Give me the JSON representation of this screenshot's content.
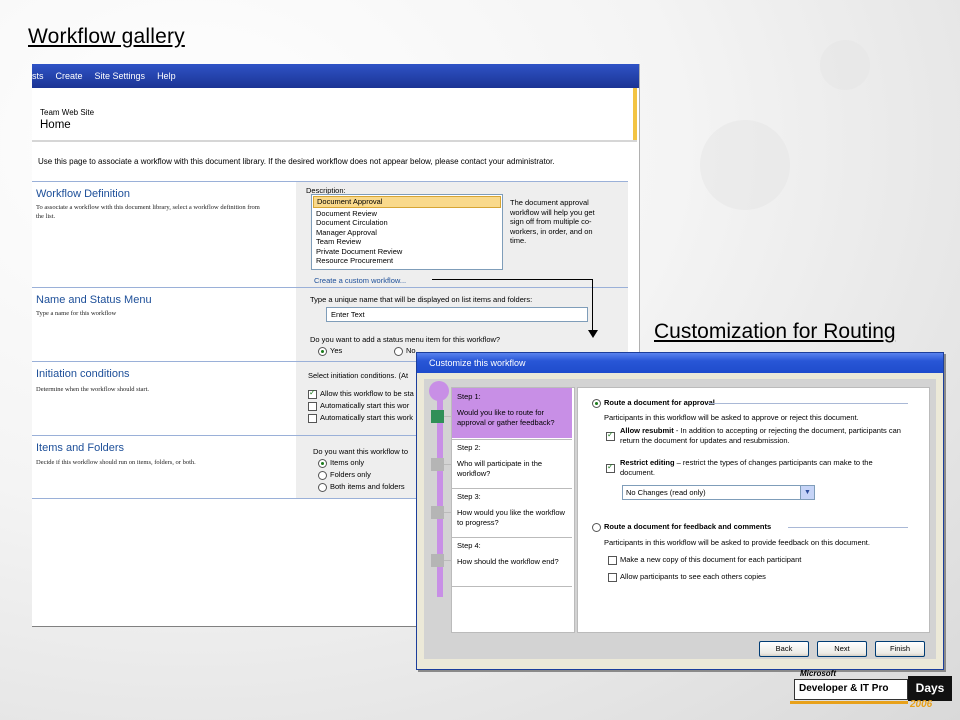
{
  "slide": {
    "title": "Workflow gallery",
    "caption": "Customization for Routing"
  },
  "sharepoint": {
    "nav": [
      "sts",
      "Create",
      "Site Settings",
      "Help"
    ],
    "site_name": "Team Web Site",
    "page_name": "Home",
    "intro": "Use this page to associate a workflow with this document library.  If the desired workflow does not appear below, please contact your administrator.",
    "sections": {
      "workflow_definition": {
        "heading": "Workflow Definition",
        "desc": "To associate a workflow with this document library, select a workflow definition from the list.",
        "description_label": "Description:",
        "items": [
          "Document Approval",
          "Document Review",
          "Document Circulation",
          "Manager Approval",
          "Team Review",
          "Private Document Review",
          "Resource Procurement"
        ],
        "selected_description": "The document approval workflow will help you get sign off from multiple co-workers, in order, and on time.",
        "custom_link": "Create a custom workflow..."
      },
      "name_status": {
        "heading": "Name and Status Menu",
        "desc": "Type a name for this workflow",
        "name_prompt": "Type a unique name that will be displayed on list items and folders:",
        "name_value": "Enter Text",
        "status_prompt": "Do you want to add a status menu item for this workflow?",
        "yes_label": "Yes",
        "no_label": "No"
      },
      "initiation": {
        "heading": "Initiation conditions",
        "desc": "Determine when the workflow should start.",
        "prompt": "Select initiation conditions.  (At",
        "options": [
          "Allow this workflow to be sta",
          "Automatically start this wor",
          "Automatically start this work"
        ]
      },
      "items_folders": {
        "heading": "Items and Folders",
        "desc": "Decide if this workflow should run on items, folders, or both.",
        "prompt": "Do you want this workflow to",
        "options": [
          "Items only",
          "Folders only",
          "Both items and folders"
        ]
      }
    }
  },
  "dialog": {
    "title": "Customize this workflow",
    "steps": [
      {
        "title": "Step 1:",
        "question": "Would you like to route for approval or gather feedback?"
      },
      {
        "title": "Step 2:",
        "question": "Who will participate in the workflow?"
      },
      {
        "title": "Step 3:",
        "question": "How would you like the workflow to progress?"
      },
      {
        "title": "Step 4:",
        "question": "How should the workflow end?"
      }
    ],
    "approval": {
      "label": "Route a document for approval",
      "desc": "Participants in this workflow will be asked to approve or reject this document.",
      "resubmit_bold": "Allow resubmit",
      "resubmit_text": " - In addition to accepting or rejecting the document, participants can return the document for updates and resubmission.",
      "restrict_bold": "Restrict editing",
      "restrict_text": " – restrict the types of changes participants can make to the document.",
      "dropdown_value": "No Changes (read only)"
    },
    "feedback": {
      "label": "Route a document for feedback and comments",
      "desc": "Participants in this workflow will be asked to provide feedback on this document.",
      "opt_copy": "Make a new copy of this document for each participant",
      "opt_see": "Allow participants to see each others copies"
    },
    "buttons": {
      "back": "Back",
      "next": "Next",
      "finish": "Finish"
    }
  },
  "logo": {
    "microsoft": "Microsoft",
    "product": "Developer & IT Pro",
    "days": "Days",
    "year": "2006"
  }
}
